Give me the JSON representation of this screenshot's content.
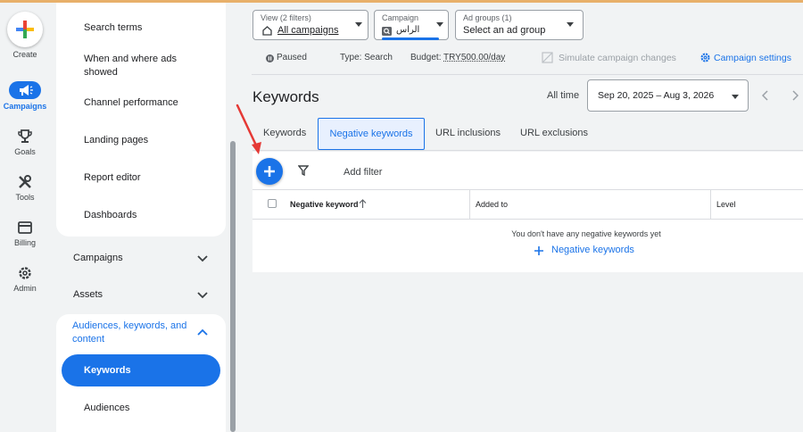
{
  "rail": {
    "create_label": "Create",
    "items": [
      {
        "label": "Campaigns",
        "icon": "megaphone-icon",
        "active": true
      },
      {
        "label": "Goals",
        "icon": "trophy-icon"
      },
      {
        "label": "Tools",
        "icon": "tools-icon"
      },
      {
        "label": "Billing",
        "icon": "credit-card-icon"
      },
      {
        "label": "Admin",
        "icon": "gear-icon"
      }
    ]
  },
  "nav": {
    "items": [
      "Search terms",
      "When and where ads showed",
      "Channel performance",
      "Landing pages",
      "Report editor",
      "Dashboards"
    ],
    "sections": [
      {
        "label": "Campaigns",
        "expanded": false
      },
      {
        "label": "Assets",
        "expanded": false
      },
      {
        "label": "Audiences, keywords, and content",
        "expanded": true
      }
    ],
    "subitems": [
      {
        "label": "Keywords",
        "active": true
      },
      {
        "label": "Audiences"
      }
    ]
  },
  "filters": {
    "view_small": "View (2 filters)",
    "view_main": "All campaigns",
    "campaign_small": "Campaign",
    "campaign_main": "الراس",
    "adgroup_small": "Ad groups (1)",
    "adgroup_main": "Select an ad group"
  },
  "status": {
    "state": "Paused",
    "type": "Type: Search",
    "budget_label": "Budget:",
    "budget_value": "TRY500.00/day",
    "simulate": "Simulate campaign changes",
    "settings": "Campaign settings"
  },
  "page": {
    "title": "Keywords",
    "range_label": "All time",
    "date_range": "Sep 20, 2025 – Aug 3, 2026"
  },
  "tabs": [
    "Keywords",
    "Negative keywords",
    "URL inclusions",
    "URL exclusions"
  ],
  "active_tab": 1,
  "table": {
    "add_filter": "Add filter",
    "columns": [
      "Negative keyword",
      "Added to",
      "Level"
    ],
    "empty_message": "You don't have any negative keywords yet",
    "empty_link": "Negative keywords"
  },
  "colors": {
    "accent": "#1a73e8",
    "arrow": "#e53935"
  }
}
